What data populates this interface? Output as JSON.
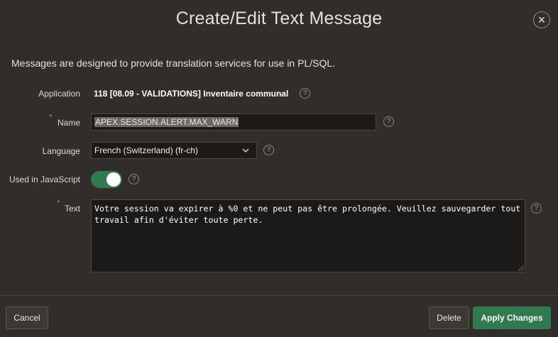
{
  "dialog": {
    "title": "Create/Edit Text Message",
    "close_symbol": "×"
  },
  "intro": "Messages are designed to provide translation services for use in PL/SQL.",
  "form": {
    "application": {
      "label": "Application",
      "value": "118 [08.09 - VALIDATIONS] Inventaire communal"
    },
    "name": {
      "label": "Name",
      "required_marker": "*",
      "value": "APEX.SESSION.ALERT.MAX_WARN"
    },
    "language": {
      "label": "Language",
      "selected": "French (Switzerland) (fr-ch)"
    },
    "used_in_javascript": {
      "label": "Used in JavaScript",
      "state": "on"
    },
    "text": {
      "label": "Text",
      "required_marker": "*",
      "value": "Votre session va expirer à %0 et ne peut pas être prolongée. Veuillez sauvegarder tout\ntravail afin d'éviter toute perte."
    },
    "help_symbol": "?"
  },
  "buttons": {
    "cancel": "Cancel",
    "delete": "Delete",
    "apply": "Apply Changes"
  },
  "icons": {
    "help": "help-icon",
    "close": "close-icon",
    "dropdown": "chevron-down-icon"
  },
  "colors": {
    "background": "#312d2a",
    "primary": "#2f7a4f",
    "required": "#e06050"
  }
}
